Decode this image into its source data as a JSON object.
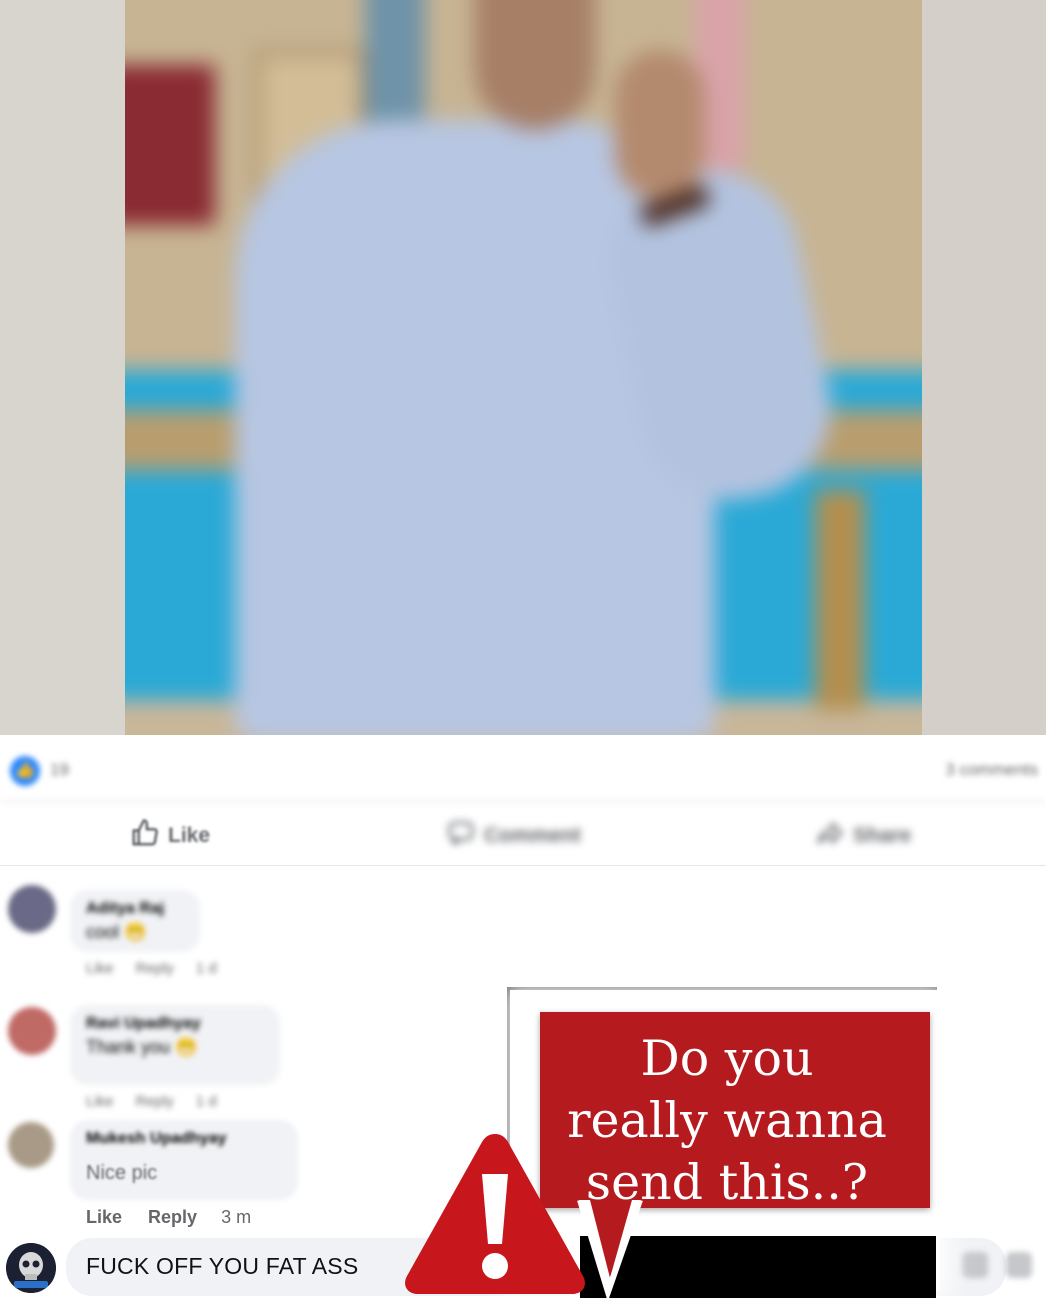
{
  "post": {
    "reaction_icon": "like-reaction-icon",
    "reaction_count": "19",
    "comments_count": "3 comments"
  },
  "actions": {
    "like": "Like",
    "comment": "Comment",
    "share": "Share"
  },
  "comments": [
    {
      "name": "Aditya Raj",
      "text": "cool 😁",
      "like": "Like",
      "reply": "Reply",
      "time": "1 d"
    },
    {
      "name": "Ravi Upadhyay",
      "text": "Thank you 😁",
      "like": "Like",
      "reply": "Reply",
      "time": "1 d"
    },
    {
      "name": "Mukesh Upadhyay",
      "text": "Nice pic",
      "like": "Like",
      "reply": "Reply",
      "time": "3 m"
    }
  ],
  "composer": {
    "value": "FUCK OFF YOU FAT ASS"
  },
  "warning": {
    "line1": "Do you",
    "line2": "really wanna",
    "line3": "send this..?",
    "accent": "#b51a1f",
    "icon": "warning-triangle-icon"
  },
  "colors": {
    "fb_blue": "#2d88ff",
    "bubble_bg": "#f0f2f5",
    "meta_text": "#65676b"
  }
}
